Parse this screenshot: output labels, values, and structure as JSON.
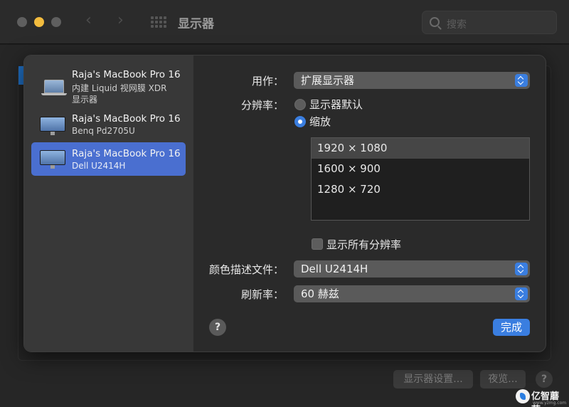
{
  "window": {
    "title": "显示器",
    "search_placeholder": "搜索"
  },
  "background": {
    "display_settings_button": "显示器设置...",
    "night_shift_button": "夜览...",
    "help_label": "?"
  },
  "watermark": {
    "text": "亿智蘑菇",
    "url": "www.yzmg.com"
  },
  "sidebar": {
    "items": [
      {
        "name": "Raja's MacBook Pro 16",
        "sub1": "内建 Liquid 视网膜 XDR",
        "sub2": "显示器",
        "icon": "laptop-icon",
        "selected": false
      },
      {
        "name": "Raja's MacBook Pro 16",
        "sub1": "Benq Pd2705U",
        "icon": "monitor-icon",
        "selected": false
      },
      {
        "name": "Raja's MacBook Pro 16",
        "sub1": "Dell U2414H",
        "icon": "monitor-icon",
        "selected": true
      }
    ]
  },
  "settings": {
    "use_as_label": "用作：",
    "use_as_value": "扩展显示器",
    "resolution_label": "分辨率：",
    "resolution_options": {
      "default": "显示器默认",
      "scaled": "缩放"
    },
    "resolution_selected": "scaled",
    "resolutions": [
      "1920 × 1080",
      "1600 × 900",
      "1280 × 720"
    ],
    "resolution_selected_index": 0,
    "show_all_label": "显示所有分辨率",
    "show_all_checked": false,
    "color_profile_label": "颜色描述文件：",
    "color_profile_value": "Dell U2414H",
    "refresh_rate_label": "刷新率：",
    "refresh_rate_value": "60 赫兹",
    "help_label": "?",
    "done_button": "完成"
  },
  "colors": {
    "accent": "#3a7ee0",
    "sidebar_selected": "#4a6fd0",
    "minimize_button": "#f3bc3e"
  }
}
